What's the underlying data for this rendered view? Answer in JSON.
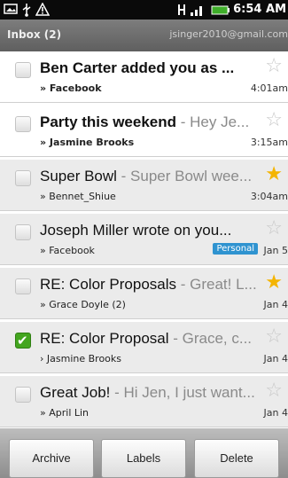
{
  "status_bar": {
    "icons": [
      "picture-icon",
      "usb-icon",
      "warning-icon",
      "network-icon",
      "signal-icon",
      "battery-icon"
    ],
    "time": "6:54 AM"
  },
  "inbox_bar": {
    "title": "Inbox (2)",
    "account": "jsinger2010@gmail.com"
  },
  "messages": [
    {
      "subject": "Ben Carter added you as ...",
      "snippet": "",
      "from": "» Facebook",
      "date": "4:01am",
      "unread": true,
      "starred": false,
      "checked": false,
      "label": ""
    },
    {
      "subject": "Party this weekend",
      "snippet": " - Hey Je...",
      "from": "» Jasmine Brooks",
      "date": "3:15am",
      "unread": true,
      "starred": false,
      "checked": false,
      "label": ""
    },
    {
      "subject": "Super Bowl",
      "snippet": " - Super Bowl wee...",
      "from": "» Bennet_Shiue",
      "date": "3:04am",
      "unread": false,
      "starred": true,
      "checked": false,
      "label": ""
    },
    {
      "subject": "Joseph Miller wrote on you...",
      "snippet": "",
      "from": "» Facebook",
      "date": "Jan 5",
      "unread": false,
      "starred": false,
      "checked": false,
      "label": "Personal"
    },
    {
      "subject": "RE: Color Proposals",
      "snippet": " - Great! L...",
      "from": "» Grace Doyle (2)",
      "date": "Jan 4",
      "unread": false,
      "starred": true,
      "checked": false,
      "label": ""
    },
    {
      "subject": "RE: Color Proposal",
      "snippet": " - Grace, c...",
      "from": "› Jasmine Brooks",
      "date": "Jan 4",
      "unread": false,
      "starred": false,
      "checked": true,
      "label": ""
    },
    {
      "subject": "Great Job!",
      "snippet": " - Hi Jen, I just want...",
      "from": "» April Lin",
      "date": "Jan 4",
      "unread": false,
      "starred": false,
      "checked": false,
      "label": ""
    }
  ],
  "actions": {
    "archive": "Archive",
    "labels": "Labels",
    "delete": "Delete"
  }
}
